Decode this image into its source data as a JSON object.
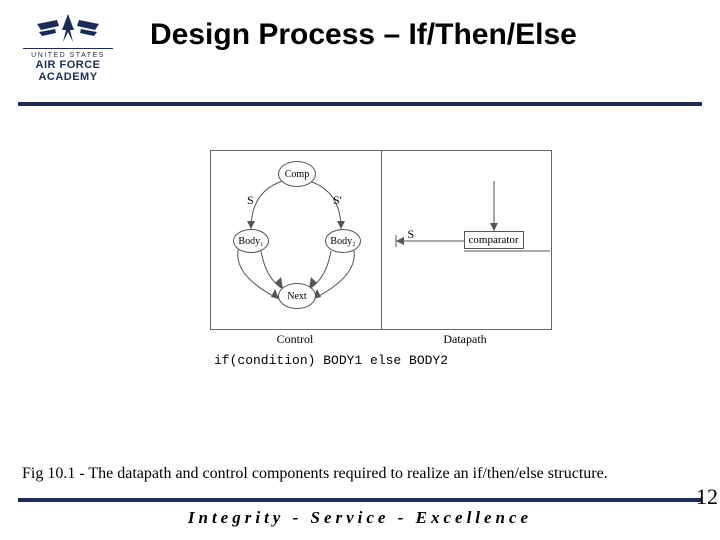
{
  "logo": {
    "line1": "UNITED STATES",
    "line2": "AIR FORCE",
    "line3": "ACADEMY"
  },
  "title": "Design Process – If/Then/Else",
  "diagram": {
    "control": {
      "name": "Control",
      "nodes": {
        "comp": "Comp",
        "body1": "Body₁",
        "body2": "Body₂",
        "next": "Next"
      },
      "edges": {
        "s": "S",
        "sbar": "S'"
      }
    },
    "datapath": {
      "name": "Datapath",
      "s": "S",
      "comparator": "comparator"
    },
    "code": "if(condition) BODY1 else BODY2"
  },
  "caption": "Fig 10.1 - The datapath and control components required to realize an if/then/else structure.",
  "footer": "Integrity - Service - Excellence",
  "page": "12"
}
